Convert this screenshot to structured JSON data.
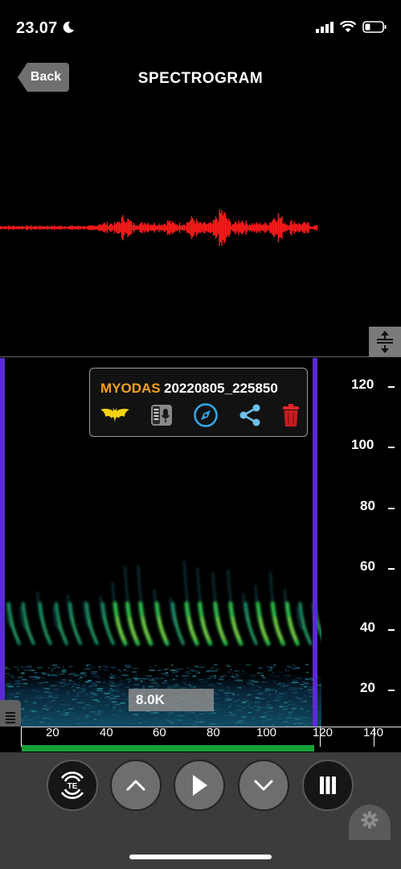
{
  "status_bar": {
    "time": "23.07",
    "icons": [
      "moon-icon",
      "signal-icon",
      "wifi-icon",
      "battery-icon"
    ]
  },
  "header": {
    "back_label": "Back",
    "title": "SPECTROGRAM"
  },
  "recording": {
    "species": "MYODAS",
    "filename": "20220805_225850"
  },
  "info_actions": [
    "bat-icon",
    "detector-icon",
    "compass-icon",
    "share-icon",
    "trash-icon"
  ],
  "frequency_readout": "8.0K",
  "y_axis": {
    "labels": [
      "120",
      "100",
      "80",
      "60",
      "40",
      "20"
    ]
  },
  "x_axis": {
    "labels": [
      "20",
      "40",
      "60",
      "80",
      "100",
      "120",
      "140"
    ]
  },
  "toolbar": {
    "te_label": "TE",
    "buttons": [
      "te-button",
      "up-button",
      "play-button",
      "down-button",
      "pause-button"
    ]
  },
  "colors": {
    "waveform": "#ff1a1a",
    "marker": "#5a2bd3",
    "species": "#f0a21e",
    "progress": "#18a33a"
  }
}
